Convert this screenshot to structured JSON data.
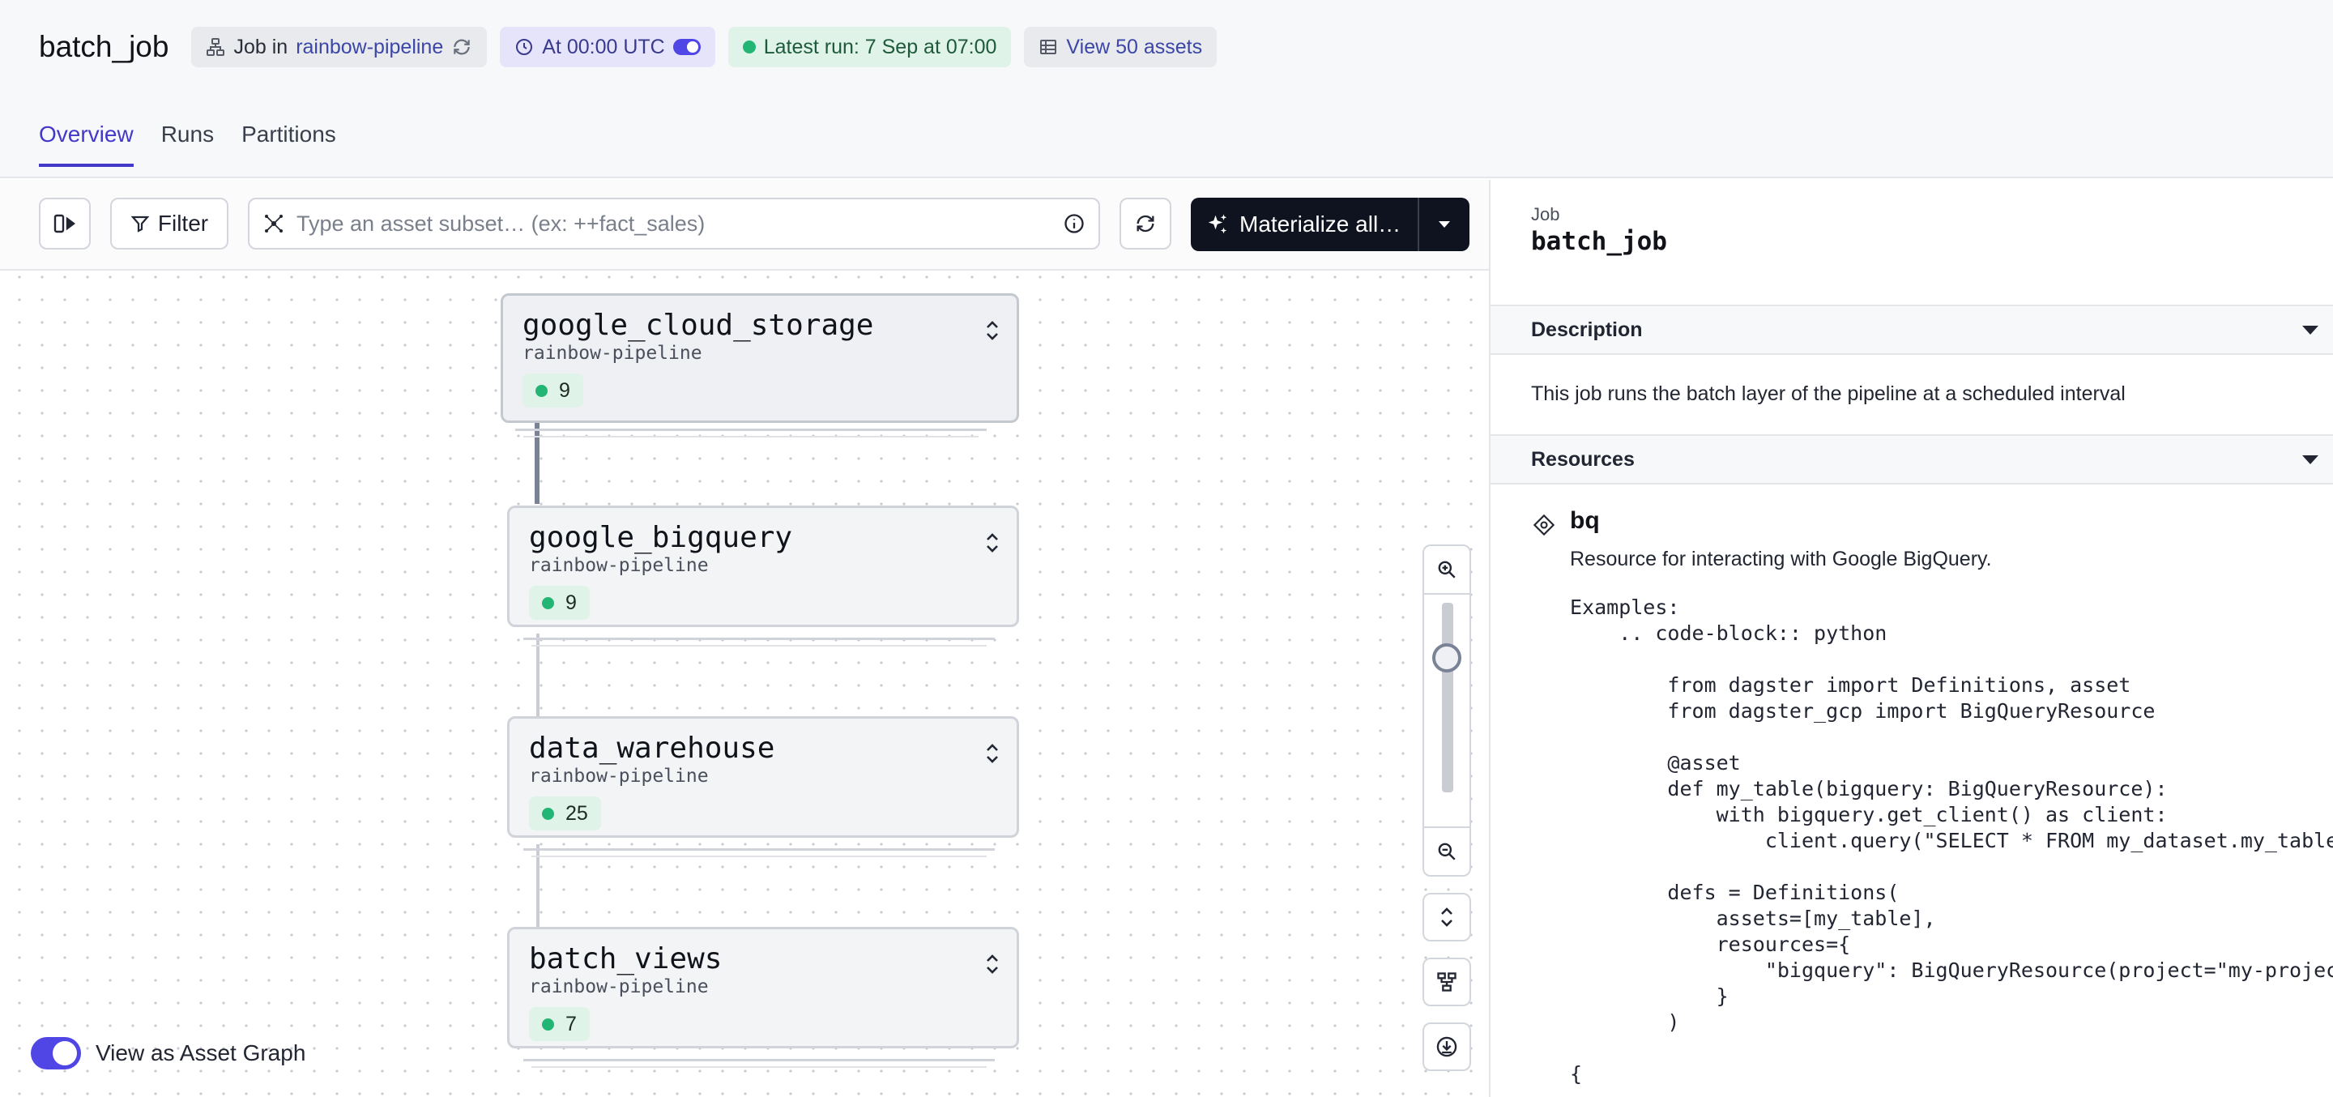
{
  "header": {
    "title": "batch_job",
    "tags": {
      "job_prefix": "Job in",
      "job_location": "rainbow-pipeline",
      "schedule": "At 00:00 UTC",
      "latest_run": "Latest run: 7 Sep at 07:00",
      "assets": "View 50 assets"
    },
    "colors": {
      "accent": "#4338ca",
      "schedule_bg": "#e6e4fb",
      "success": "#22b573"
    }
  },
  "tabs": [
    {
      "label": "Overview",
      "active": true
    },
    {
      "label": "Runs",
      "active": false
    },
    {
      "label": "Partitions",
      "active": false
    }
  ],
  "toolbar": {
    "filter_label": "Filter",
    "search_placeholder": "Type an asset subset… (ex: ++fact_sales)",
    "materialize_label": "Materialize all…"
  },
  "graph": {
    "nodes": [
      {
        "name": "google_cloud_storage",
        "location": "rainbow-pipeline",
        "count": "9"
      },
      {
        "name": "google_bigquery",
        "location": "rainbow-pipeline",
        "count": "9"
      },
      {
        "name": "data_warehouse",
        "location": "rainbow-pipeline",
        "count": "25"
      },
      {
        "name": "batch_views",
        "location": "rainbow-pipeline",
        "count": "7"
      }
    ],
    "asset_graph_toggle_label": "View as Asset Graph",
    "icons": [
      "zoom-in-icon",
      "zoom-out-icon",
      "expand-collapse-icon",
      "layout-icon",
      "download-icon"
    ]
  },
  "panel": {
    "kind": "Job",
    "title": "batch_job",
    "description_heading": "Description",
    "description": "This job runs the batch layer of the pipeline at a scheduled interval",
    "resources_heading": "Resources",
    "resource": {
      "name": "bq",
      "description": "Resource for interacting with Google BigQuery.",
      "code": "Examples:\n    .. code-block:: python\n\n        from dagster import Definitions, asset\n        from dagster_gcp import BigQueryResource\n\n        @asset\n        def my_table(bigquery: BigQueryResource):\n            with bigquery.get_client() as client:\n                client.query(\"SELECT * FROM my_dataset.my_table\")\n\n        defs = Definitions(\n            assets=[my_table],\n            resources={\n                \"bigquery\": BigQueryResource(project=\"my-project\")\n            }\n        )\n\n{"
    }
  }
}
